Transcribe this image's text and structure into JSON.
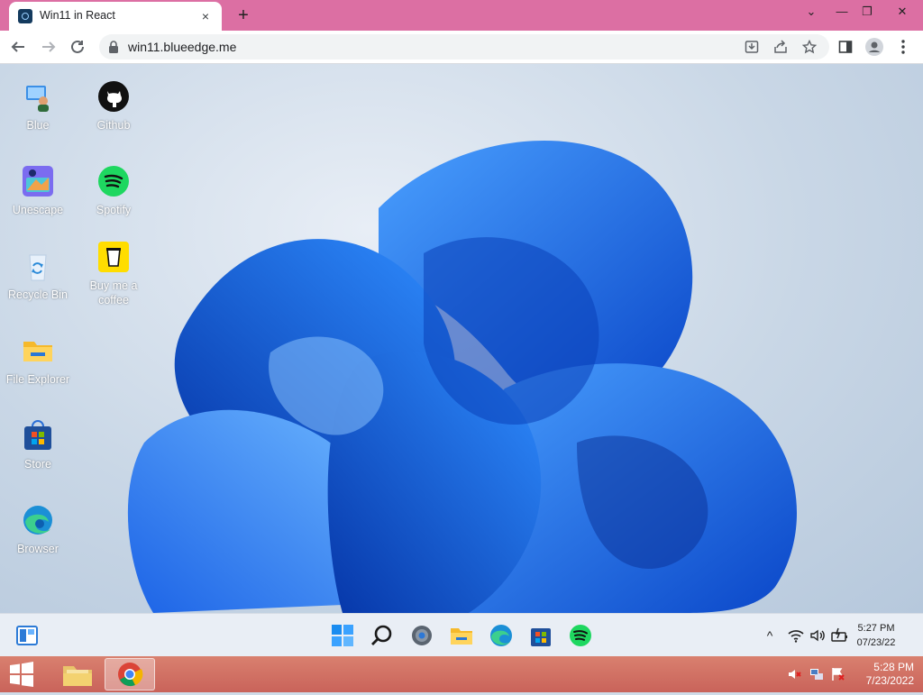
{
  "browser": {
    "tab_title": "Win11 in React",
    "tab_close": "×",
    "new_tab": "+",
    "url": "win11.blueedge.me",
    "window_controls": [
      "⌄",
      "—",
      "❐",
      "✕"
    ]
  },
  "desktop": {
    "icons": [
      {
        "label": "Blue",
        "icon": "user-pc-icon"
      },
      {
        "label": "Unescape",
        "icon": "unescape-icon"
      },
      {
        "label": "Recycle Bin",
        "icon": "recycle-bin-icon"
      },
      {
        "label": "File Explorer",
        "icon": "folder-icon"
      },
      {
        "label": "Store",
        "icon": "store-icon"
      },
      {
        "label": "Browser",
        "icon": "edge-icon"
      },
      {
        "label": "Github",
        "icon": "github-icon"
      },
      {
        "label": "Spotify",
        "icon": "spotify-icon"
      },
      {
        "label": "Buy me a coffee",
        "icon": "coffee-icon"
      }
    ]
  },
  "taskbar11": {
    "apps": [
      "widgets",
      "start",
      "search",
      "settings",
      "file-explorer",
      "edge",
      "store",
      "spotify"
    ],
    "tray_chevron": "^",
    "time": "5:27 PM",
    "date": "07/23/22"
  },
  "host_taskbar": {
    "time": "5:28 PM",
    "date": "7/23/2022"
  },
  "colors": {
    "tabstrip": "#dc6fa3",
    "host_taskbar": "#c9635a",
    "bloom_blue": "#1f6fe8"
  }
}
